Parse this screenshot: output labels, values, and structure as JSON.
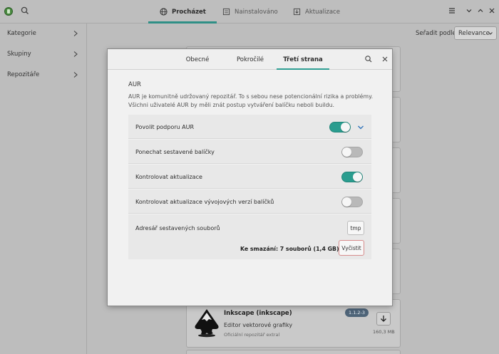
{
  "header": {
    "tabs": [
      {
        "label": "Procházet",
        "icon": "globe-icon",
        "active": true
      },
      {
        "label": "Nainstalováno",
        "icon": "installed-icon",
        "active": false
      },
      {
        "label": "Aktualizace",
        "icon": "updates-icon",
        "active": false
      }
    ]
  },
  "sidebar": {
    "items": [
      {
        "label": "Kategorie"
      },
      {
        "label": "Skupiny"
      },
      {
        "label": "Repozitáře"
      }
    ]
  },
  "sort": {
    "label": "Seřadit podle",
    "value": "Relevance"
  },
  "package_card": {
    "title": "Inkscape (inkscape)",
    "description": "Editor vektorové grafiky",
    "repository": "Oficiální repozitář extral",
    "version": "1.1.2-3",
    "size": "160,3 MB"
  },
  "dialog": {
    "tabs": [
      {
        "label": "Obecné",
        "active": false
      },
      {
        "label": "Pokročilé",
        "active": false
      },
      {
        "label": "Třetí strana",
        "active": true
      }
    ],
    "section_title": "AUR",
    "section_description_line1": "AUR je komunitně udržovaný repozitář. To s sebou nese potencionální rizika a problémy.",
    "section_description_line2": "Všichni uživatelé AUR by měli znát postup vytváření balíčku neboli buildu.",
    "settings": [
      {
        "label": "Povolit podporu AUR",
        "enabled": true
      },
      {
        "label": "Ponechat sestavené balíčky",
        "enabled": false
      },
      {
        "label": "Kontrolovat aktualizace",
        "enabled": true
      },
      {
        "label": "Kontrolovat aktualizace vývojových verzí balíčků",
        "enabled": false
      }
    ],
    "build_dir": {
      "label": "Adresář sestavených souborů",
      "button": "tmp",
      "to_delete": "Ke smazání:  7 souborů  (1,4 GB)",
      "clean_button": "Vyčistit"
    }
  },
  "colors": {
    "accent": "#2a9d8f",
    "destructive_border": "#d78c8c"
  }
}
